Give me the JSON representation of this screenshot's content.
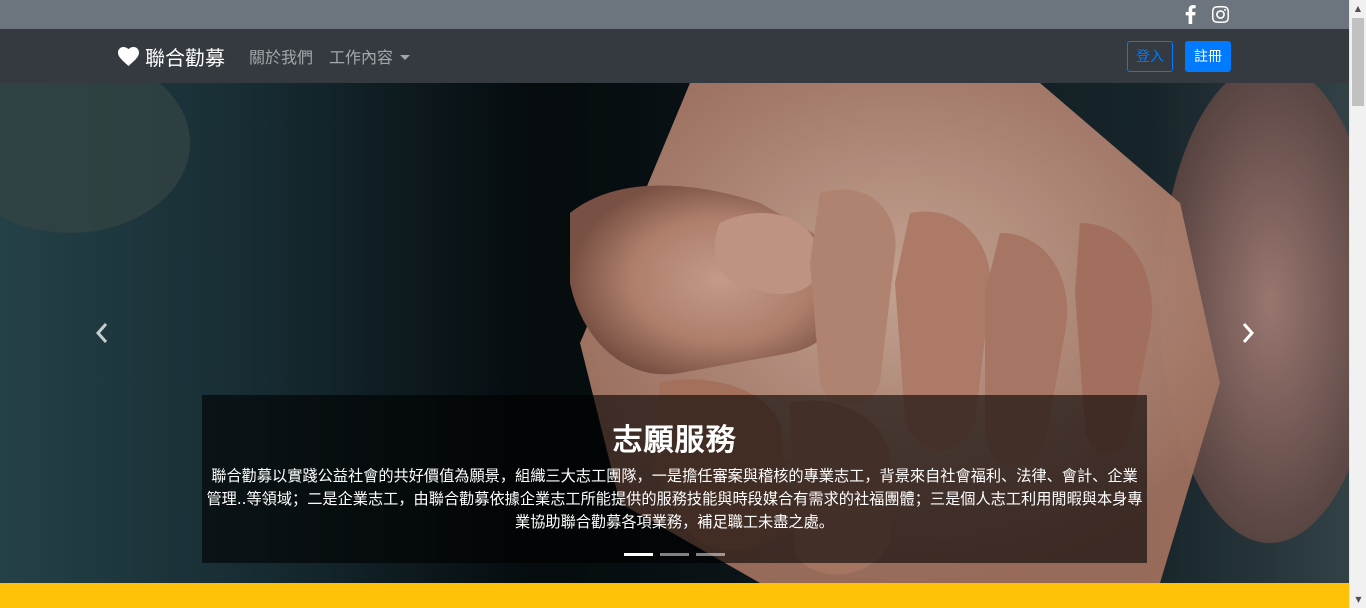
{
  "social": {
    "facebook_icon": "facebook-icon",
    "instagram_icon": "instagram-icon"
  },
  "navbar": {
    "brand": "聯合勸募",
    "about": "關於我們",
    "work": "工作內容",
    "login": "登入",
    "register": "註冊"
  },
  "carousel": {
    "title": "志願服務",
    "text": "聯合勸募以實踐公益社會的共好價值為願景，組織三大志工團隊，一是擔任審案與稽核的專業志工，背景來自社會福利、法律、會計、企業管理..等領域；二是企業志工，由聯合勸募依據企業志工所能提供的服務技能與時段媒合有需求的社福團體；三是個人志工利用閒暇與本身專業協助聯合勸募各項業務，補足職工未盡之處。",
    "slides": 3,
    "active_slide": 1
  },
  "colors": {
    "topbar": "#6c757d",
    "navbar": "#343a40",
    "primary": "#007bff",
    "band": "#ffc107"
  }
}
